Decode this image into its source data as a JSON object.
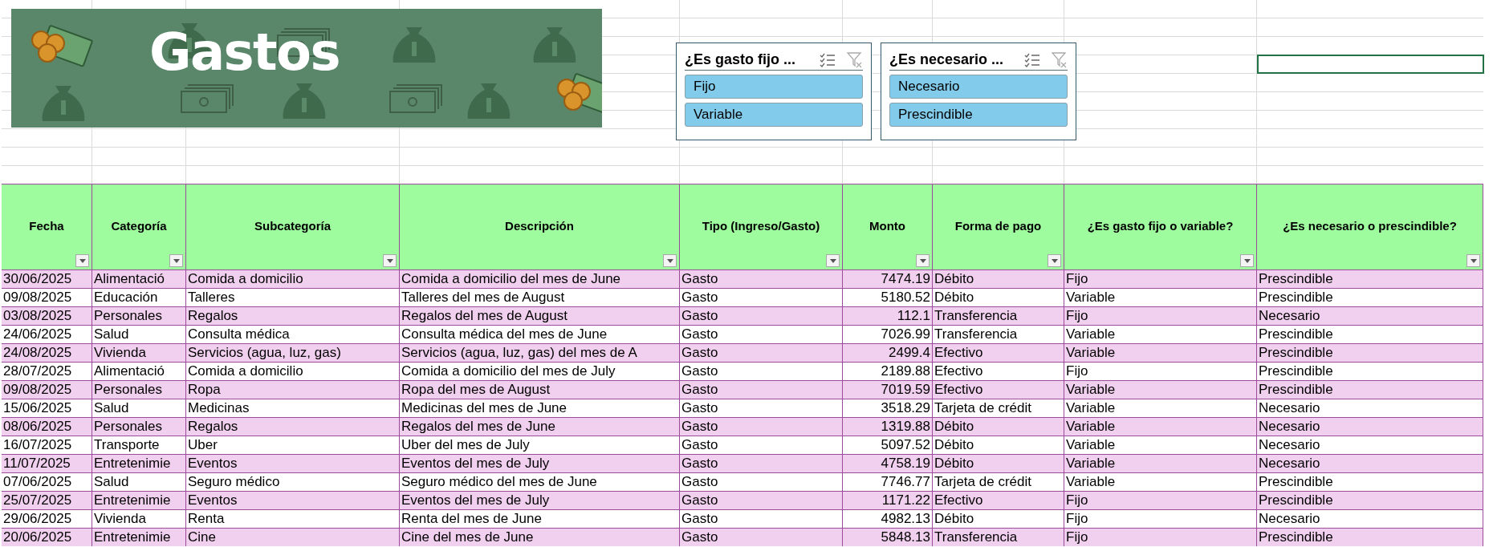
{
  "banner": {
    "title": "Gastos"
  },
  "slicers": [
    {
      "title": "¿Es gasto fijo ...",
      "items": [
        {
          "label": "Fijo",
          "selected": true
        },
        {
          "label": "Variable",
          "selected": true
        }
      ]
    },
    {
      "title": "¿Es necesario ...",
      "items": [
        {
          "label": "Necesario",
          "selected": true
        },
        {
          "label": "Prescindible",
          "selected": true
        }
      ]
    }
  ],
  "table": {
    "columns": [
      {
        "label": "Fecha",
        "kind": "text"
      },
      {
        "label": "Categoría",
        "kind": "text"
      },
      {
        "label": "Subcategoría",
        "kind": "text"
      },
      {
        "label": "Descripción",
        "kind": "text"
      },
      {
        "label": "Tipo (Ingreso/Gasto)",
        "kind": "text"
      },
      {
        "label": "Monto",
        "kind": "number"
      },
      {
        "label": "Forma de pago",
        "kind": "text"
      },
      {
        "label": "¿Es gasto fijo o variable?",
        "kind": "text"
      },
      {
        "label": "¿Es necesario o prescindible?",
        "kind": "text"
      }
    ],
    "rows": [
      [
        "30/06/2025",
        "Alimentació",
        "Comida a domicilio",
        "Comida a domicilio del mes de June",
        "Gasto",
        "7474.19",
        "Débito",
        "Fijo",
        "Prescindible"
      ],
      [
        "09/08/2025",
        "Educación",
        "Talleres",
        "Talleres del mes de August",
        "Gasto",
        "5180.52",
        "Débito",
        "Variable",
        "Prescindible"
      ],
      [
        "03/08/2025",
        "Personales",
        "Regalos",
        "Regalos del mes de August",
        "Gasto",
        "112.1",
        "Transferencia",
        "Fijo",
        "Necesario"
      ],
      [
        "24/06/2025",
        "Salud",
        "Consulta médica",
        "Consulta médica del mes de June",
        "Gasto",
        "7026.99",
        "Transferencia",
        "Variable",
        "Prescindible"
      ],
      [
        "24/08/2025",
        "Vivienda",
        "Servicios (agua, luz, gas)",
        "Servicios (agua, luz, gas) del mes de A",
        "Gasto",
        "2499.4",
        "Efectivo",
        "Variable",
        "Prescindible"
      ],
      [
        "28/07/2025",
        "Alimentació",
        "Comida a domicilio",
        "Comida a domicilio del mes de July",
        "Gasto",
        "2189.88",
        "Efectivo",
        "Fijo",
        "Prescindible"
      ],
      [
        "09/08/2025",
        "Personales",
        "Ropa",
        "Ropa del mes de August",
        "Gasto",
        "7019.59",
        "Efectivo",
        "Variable",
        "Prescindible"
      ],
      [
        "15/06/2025",
        "Salud",
        "Medicinas",
        "Medicinas del mes de June",
        "Gasto",
        "3518.29",
        "Tarjeta de crédit",
        "Variable",
        "Necesario"
      ],
      [
        "08/06/2025",
        "Personales",
        "Regalos",
        "Regalos del mes de June",
        "Gasto",
        "1319.88",
        "Débito",
        "Variable",
        "Necesario"
      ],
      [
        "16/07/2025",
        "Transporte",
        "Uber",
        "Uber del mes de July",
        "Gasto",
        "5097.52",
        "Débito",
        "Variable",
        "Necesario"
      ],
      [
        "11/07/2025",
        "Entretenimie",
        "Eventos",
        "Eventos del mes de July",
        "Gasto",
        "4758.19",
        "Débito",
        "Variable",
        "Necesario"
      ],
      [
        "07/06/2025",
        "Salud",
        "Seguro médico",
        "Seguro médico del mes de June",
        "Gasto",
        "7746.77",
        "Tarjeta de crédit",
        "Variable",
        "Prescindible"
      ],
      [
        "25/07/2025",
        "Entretenimie",
        "Eventos",
        "Eventos del mes de July",
        "Gasto",
        "1171.22",
        "Efectivo",
        "Fijo",
        "Prescindible"
      ],
      [
        "29/06/2025",
        "Vivienda",
        "Renta",
        "Renta del mes de June",
        "Gasto",
        "4982.13",
        "Débito",
        "Fijo",
        "Necesario"
      ],
      [
        "20/06/2025",
        "Entretenimie",
        "Cine",
        "Cine del mes de June",
        "Gasto",
        "5848.13",
        "Transferencia",
        "Fijo",
        "Prescindible"
      ]
    ]
  }
}
